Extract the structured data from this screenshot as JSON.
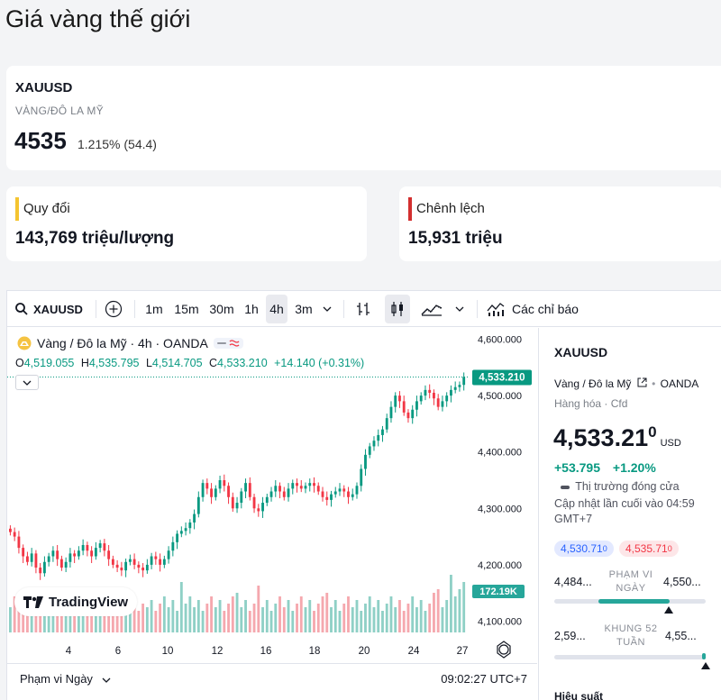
{
  "page": {
    "title": "Giá vàng thế giới"
  },
  "ticker": {
    "symbol": "XAUUSD",
    "name": "VÀNG/ĐÔ LA MỸ",
    "price": "4535",
    "change": "1.215% (54.4)"
  },
  "conversion": {
    "label": "Quy đổi",
    "value": "143,769 triệu/lượng",
    "accent": "#f4c430"
  },
  "spread": {
    "label": "Chênh lệch",
    "value": "15,931 triệu",
    "accent": "#d32f2f"
  },
  "toolbar": {
    "symbol": "XAUUSD",
    "intervals": [
      "1m",
      "15m",
      "30m",
      "1h",
      "4h",
      "3m"
    ],
    "active_interval": "4h",
    "indicators_label": "Các chỉ báo"
  },
  "chart_legend": {
    "title": "Vàng / Đô la Mỹ · 4h · OANDA",
    "o_label": "O",
    "o": "4,519.055",
    "h_label": "H",
    "h": "4,535.795",
    "l_label": "L",
    "l": "4,514.705",
    "c_label": "C",
    "c": "4,533.210",
    "change": "+14.140 (+0.31%)"
  },
  "branding": {
    "logo_text": "TradingView"
  },
  "bottom": {
    "range_label": "Phạm vi Ngày",
    "clock": "09:02:27 UTC+7"
  },
  "side": {
    "symbol": "XAUUSD",
    "desc": "Vàng / Đô la Mỹ",
    "exchange": "OANDA",
    "category": "Hàng hóa · Cfd",
    "price_main": "4,533.21",
    "price_sup": "0",
    "currency": "USD",
    "change_abs": "+53.795",
    "change_pct": "+1.20%",
    "market_status": "Thị trường đóng cửa",
    "updated": "Cập nhật lần cuối vào 04:59 GMT+7",
    "bid": "4,530.71",
    "bid_sup": "0",
    "ask": "4,535.71",
    "ask_sup": "0",
    "day_low": "4,484...",
    "day_high": "4,550...",
    "day_label": "PHẠM VI NGÀY",
    "wk_low": "2,59...",
    "wk_high": "4,55...",
    "wk_label": "KHUNG 52 TUẦN",
    "performance": "Hiệu suất"
  },
  "colors": {
    "up": "#089981",
    "down": "#f23645",
    "up_vol": "#8fd0c6",
    "down_vol": "#f5a8ae",
    "price_tag": "#089981"
  },
  "chart_data": {
    "type": "candlestick",
    "title": "Vàng / Đô la Mỹ · 4h · OANDA",
    "y_ticks": [
      "4,600.000",
      "4,500.000",
      "4,400.000",
      "4,300.000",
      "4,200.000",
      "4,100.000"
    ],
    "x_ticks": [
      "4",
      "6",
      "10",
      "12",
      "16",
      "18",
      "20",
      "24",
      "27"
    ],
    "ylim": [
      4080,
      4620
    ],
    "last_price": "4,533.210",
    "volume_label": "172.19K",
    "closes": [
      4258,
      4250,
      4230,
      4215,
      4205,
      4220,
      4195,
      4185,
      4205,
      4215,
      4225,
      4210,
      4195,
      4205,
      4220,
      4215,
      4225,
      4235,
      4225,
      4215,
      4230,
      4238,
      4225,
      4210,
      4200,
      4195,
      4190,
      4205,
      4210,
      4200,
      4195,
      4190,
      4200,
      4215,
      4210,
      4200,
      4210,
      4225,
      4240,
      4255,
      4260,
      4265,
      4275,
      4290,
      4320,
      4345,
      4335,
      4320,
      4335,
      4350,
      4340,
      4320,
      4300,
      4310,
      4330,
      4345,
      4320,
      4300,
      4295,
      4310,
      4320,
      4330,
      4340,
      4330,
      4320,
      4335,
      4345,
      4340,
      4335,
      4340,
      4345,
      4340,
      4330,
      4320,
      4315,
      4325,
      4330,
      4335,
      4330,
      4320,
      4325,
      4340,
      4370,
      4395,
      4410,
      4420,
      4430,
      4440,
      4460,
      4480,
      4500,
      4490,
      4470,
      4460,
      4475,
      4490,
      4500,
      4510,
      4505,
      4495,
      4480,
      4490,
      4500,
      4510,
      4515,
      4519,
      4533
    ],
    "volumes": [
      0.35,
      0.5,
      0.4,
      0.3,
      0.45,
      0.55,
      0.3,
      0.4,
      0.35,
      0.5,
      0.45,
      0.3,
      0.4,
      0.35,
      0.5,
      0.3,
      0.4,
      0.45,
      0.35,
      0.5,
      0.4,
      0.3,
      0.35,
      0.6,
      0.45,
      0.3,
      0.4,
      0.35,
      0.5,
      0.45,
      0.3,
      0.4,
      0.35,
      0.45,
      0.3,
      0.4,
      0.5,
      0.35,
      0.45,
      0.3,
      0.7,
      0.4,
      0.5,
      0.35,
      0.45,
      0.3,
      0.4,
      0.5,
      0.35,
      0.45,
      0.3,
      0.4,
      0.5,
      0.55,
      0.35,
      0.45,
      0.3,
      0.4,
      0.65,
      0.35,
      0.45,
      0.3,
      0.4,
      0.5,
      0.35,
      0.45,
      0.3,
      0.4,
      0.5,
      0.35,
      0.45,
      0.3,
      0.4,
      0.5,
      0.55,
      0.35,
      0.45,
      0.3,
      0.4,
      0.5,
      0.35,
      0.45,
      0.3,
      0.4,
      0.5,
      0.35,
      0.45,
      0.3,
      0.4,
      0.5,
      0.35,
      0.45,
      0.3,
      0.4,
      0.5,
      0.35,
      0.45,
      0.3,
      0.4,
      0.55,
      0.6,
      0.35,
      0.45,
      0.8,
      0.5,
      0.6,
      0.7
    ]
  }
}
